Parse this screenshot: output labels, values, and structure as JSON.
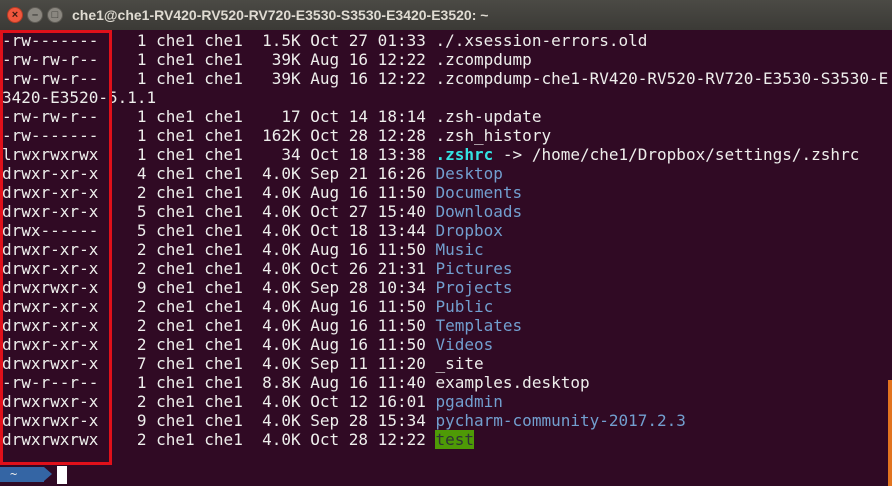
{
  "window": {
    "title": "che1@che1-RV420-RV520-RV720-E3530-S3530-E3420-E3520: ~"
  },
  "titlebar_buttons": {
    "close": "×",
    "minimize": "–",
    "maximize": "□"
  },
  "listing": [
    {
      "perm": "-rw-------",
      "links": "1",
      "owner": "che1",
      "group": "che1",
      "size": "1.5K",
      "date": "Oct 27 01:33",
      "name": "./.xsession-errors.old",
      "kind": "file"
    },
    {
      "perm": "-rw-rw-r--",
      "links": "1",
      "owner": "che1",
      "group": "che1",
      "size": "39K",
      "date": "Aug 16 12:22",
      "name": ".zcompdump",
      "kind": "file"
    },
    {
      "perm": "-rw-rw-r--",
      "links": "1",
      "owner": "che1",
      "group": "che1",
      "size": "39K",
      "date": "Aug 16 12:22",
      "name": ".zcompdump-che1-RV420-RV520-RV720-E3530-S3530-E3420-E3520-5.1.1",
      "kind": "file"
    },
    {
      "perm": "-rw-rw-r--",
      "links": "1",
      "owner": "che1",
      "group": "che1",
      "size": "17",
      "date": "Oct 14 18:14",
      "name": ".zsh-update",
      "kind": "file"
    },
    {
      "perm": "-rw-------",
      "links": "1",
      "owner": "che1",
      "group": "che1",
      "size": "162K",
      "date": "Oct 28 12:28",
      "name": ".zsh_history",
      "kind": "file"
    },
    {
      "perm": "lrwxrwxrwx",
      "links": "1",
      "owner": "che1",
      "group": "che1",
      "size": "34",
      "date": "Oct 18 13:38",
      "name": ".zshrc",
      "target": "/home/che1/Dropbox/settings/.zshrc",
      "arrow": "->",
      "kind": "link"
    },
    {
      "perm": "drwxr-xr-x",
      "links": "4",
      "owner": "che1",
      "group": "che1",
      "size": "4.0K",
      "date": "Sep 21 16:26",
      "name": "Desktop",
      "kind": "dir"
    },
    {
      "perm": "drwxr-xr-x",
      "links": "2",
      "owner": "che1",
      "group": "che1",
      "size": "4.0K",
      "date": "Aug 16 11:50",
      "name": "Documents",
      "kind": "dir"
    },
    {
      "perm": "drwxr-xr-x",
      "links": "5",
      "owner": "che1",
      "group": "che1",
      "size": "4.0K",
      "date": "Oct 27 15:40",
      "name": "Downloads",
      "kind": "dir"
    },
    {
      "perm": "drwx------",
      "links": "5",
      "owner": "che1",
      "group": "che1",
      "size": "4.0K",
      "date": "Oct 18 13:44",
      "name": "Dropbox",
      "kind": "dir"
    },
    {
      "perm": "drwxr-xr-x",
      "links": "2",
      "owner": "che1",
      "group": "che1",
      "size": "4.0K",
      "date": "Aug 16 11:50",
      "name": "Music",
      "kind": "dir"
    },
    {
      "perm": "drwxr-xr-x",
      "links": "2",
      "owner": "che1",
      "group": "che1",
      "size": "4.0K",
      "date": "Oct 26 21:31",
      "name": "Pictures",
      "kind": "dir"
    },
    {
      "perm": "drwxrwxr-x",
      "links": "9",
      "owner": "che1",
      "group": "che1",
      "size": "4.0K",
      "date": "Sep 28 10:34",
      "name": "Projects",
      "kind": "dir"
    },
    {
      "perm": "drwxr-xr-x",
      "links": "2",
      "owner": "che1",
      "group": "che1",
      "size": "4.0K",
      "date": "Aug 16 11:50",
      "name": "Public",
      "kind": "dir"
    },
    {
      "perm": "drwxr-xr-x",
      "links": "2",
      "owner": "che1",
      "group": "che1",
      "size": "4.0K",
      "date": "Aug 16 11:50",
      "name": "Templates",
      "kind": "dir"
    },
    {
      "perm": "drwxr-xr-x",
      "links": "2",
      "owner": "che1",
      "group": "che1",
      "size": "4.0K",
      "date": "Aug 16 11:50",
      "name": "Videos",
      "kind": "dir"
    },
    {
      "perm": "drwxrwxr-x",
      "links": "7",
      "owner": "che1",
      "group": "che1",
      "size": "4.0K",
      "date": "Sep 11 11:20",
      "name": "_site",
      "kind": "plain"
    },
    {
      "perm": "-rw-r--r--",
      "links": "1",
      "owner": "che1",
      "group": "che1",
      "size": "8.8K",
      "date": "Aug 16 11:40",
      "name": "examples.desktop",
      "kind": "plain"
    },
    {
      "perm": "drwxrwxr-x",
      "links": "2",
      "owner": "che1",
      "group": "che1",
      "size": "4.0K",
      "date": "Oct 12 16:01",
      "name": "pgadmin",
      "kind": "dir"
    },
    {
      "perm": "drwxrwxr-x",
      "links": "9",
      "owner": "che1",
      "group": "che1",
      "size": "4.0K",
      "date": "Sep 28 15:34",
      "name": "pycharm-community-2017.2.3",
      "kind": "dir"
    },
    {
      "perm": "drwxrwxrwx",
      "links": "2",
      "owner": "che1",
      "group": "che1",
      "size": "4.0K",
      "date": "Oct 28 12:22",
      "name": "test",
      "kind": "sticky"
    }
  ],
  "prompt": {
    "path": "~"
  }
}
